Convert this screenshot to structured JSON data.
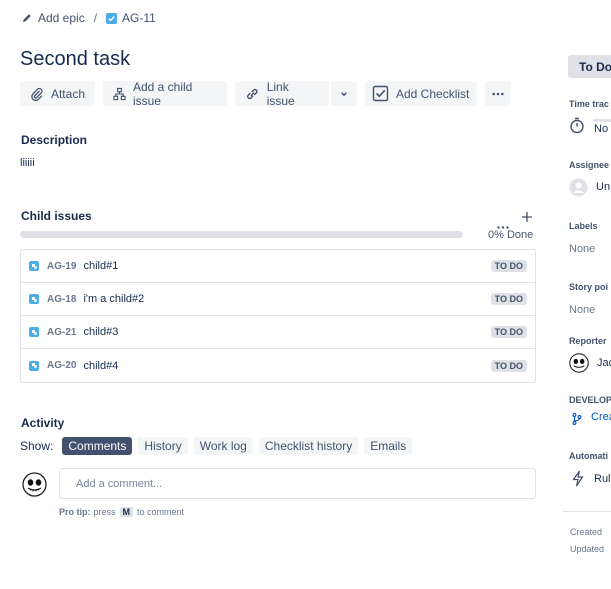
{
  "breadcrumb": {
    "epic_label": "Add epic",
    "separator": "/",
    "issue_key": "AG-11"
  },
  "issue": {
    "title": "Second task"
  },
  "toolbar": {
    "attach": "Attach",
    "add_child": "Add a child issue",
    "link_issue": "Link issue",
    "add_checklist": "Add Checklist"
  },
  "description": {
    "heading": "Description",
    "text": "liiiii"
  },
  "child_issues": {
    "heading": "Child issues",
    "progress_percent": 0,
    "progress_text": "0% Done",
    "items": [
      {
        "key": "AG-19",
        "summary": "child#1",
        "status": "TO DO"
      },
      {
        "key": "AG-18",
        "summary": "i'm a child#2",
        "status": "TO DO"
      },
      {
        "key": "AG-21",
        "summary": "child#3",
        "status": "TO DO"
      },
      {
        "key": "AG-20",
        "summary": "child#4",
        "status": "TO DO"
      }
    ]
  },
  "activity": {
    "heading": "Activity",
    "show_label": "Show:",
    "tabs": [
      "Comments",
      "History",
      "Work log",
      "Checklist history",
      "Emails"
    ],
    "active_tab": "Comments",
    "comment_placeholder": "Add a comment...",
    "protip_prefix": "Pro tip:",
    "protip_press": "press",
    "protip_key": "M",
    "protip_suffix": "to comment"
  },
  "right_panel": {
    "status": "To Do",
    "time_tracking_label": "Time trac",
    "time_tracking_value": "No",
    "assignee_label": "Assignee",
    "assignee_value": "Un",
    "labels_label": "Labels",
    "labels_value": "None",
    "story_points_label": "Story poi",
    "story_points_value": "None",
    "reporter_label": "Reporter",
    "reporter_value": "Jac",
    "development_label": "DEVELOP",
    "development_value": "Crea",
    "automation_label": "Automati",
    "automation_value": "Rul",
    "created_label": "Created",
    "updated_label": "Updated"
  },
  "colors": {
    "accent": "#0052cc",
    "text": "#172b4d",
    "subtle": "#42526e",
    "subtask_icon": "#4bade8",
    "button_bg": "#f4f5f7"
  }
}
